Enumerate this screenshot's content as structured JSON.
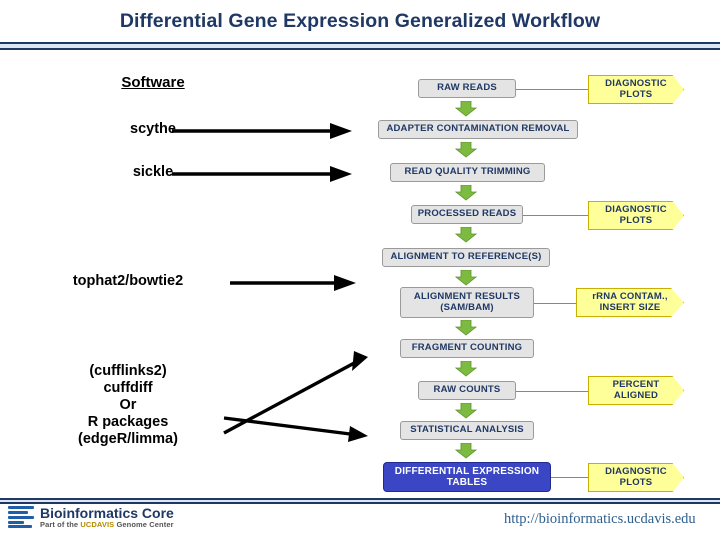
{
  "title": "Differential Gene Expression Generalized Workflow",
  "software_column": {
    "heading": "Software",
    "items": [
      {
        "label": "scythe"
      },
      {
        "label": "sickle"
      },
      {
        "label": "tophat2/bowtie2"
      },
      {
        "label": "(cufflinks2)\ncuffdiff\nOr\nR packages\n(edgeR/limma)"
      }
    ]
  },
  "flow": {
    "nodes": [
      {
        "id": "raw-reads",
        "label": "RAW READS",
        "style": "grey"
      },
      {
        "id": "adapter-contamination-removal",
        "label": "ADAPTER CONTAMINATION REMOVAL",
        "style": "grey"
      },
      {
        "id": "read-quality-trimming",
        "label": "READ QUALITY TRIMMING",
        "style": "grey"
      },
      {
        "id": "processed-reads",
        "label": "PROCESSED READS",
        "style": "grey"
      },
      {
        "id": "alignment-to-references",
        "label": "ALIGNMENT TO REFERENCE(S)",
        "style": "grey"
      },
      {
        "id": "alignment-results",
        "label": "ALIGNMENT RESULTS\n(SAM/BAM)",
        "style": "grey"
      },
      {
        "id": "fragment-counting",
        "label": "FRAGMENT COUNTING",
        "style": "grey"
      },
      {
        "id": "raw-counts",
        "label": "RAW COUNTS",
        "style": "grey"
      },
      {
        "id": "statistical-analysis",
        "label": "STATISTICAL ANALYSIS",
        "style": "grey"
      },
      {
        "id": "differential-expression-tables",
        "label": "DIFFERENTIAL EXPRESSION\nTABLES",
        "style": "blue"
      }
    ],
    "side_nodes": [
      {
        "id": "diagnostic-plots-1",
        "label": "DIAGNOSTIC\nPLOTS",
        "from": "raw-reads"
      },
      {
        "id": "diagnostic-plots-2",
        "label": "DIAGNOSTIC\nPLOTS",
        "from": "processed-reads"
      },
      {
        "id": "rrna-contam-insert-size",
        "label": "rRNA CONTAM.,\nINSERT SIZE",
        "from": "alignment-results"
      },
      {
        "id": "percent-aligned",
        "label": "PERCENT\nALIGNED",
        "from": "raw-counts"
      },
      {
        "id": "diagnostic-plots-3",
        "label": "DIAGNOSTIC\nPLOTS",
        "from": "differential-expression-tables"
      }
    ],
    "arrow_color": "#7cbb3f",
    "node_text_color": "#1f3864",
    "side_node_color": "#ffff99",
    "final_node_color": "#3b46c4"
  },
  "footer": {
    "logo_title": "Bioinformatics Core",
    "logo_sub_pre": "Part of the ",
    "logo_sub_gold": "UCDAVIS",
    "logo_sub_post": " Genome Center",
    "url": "http://bioinformatics.ucdavis.edu"
  }
}
